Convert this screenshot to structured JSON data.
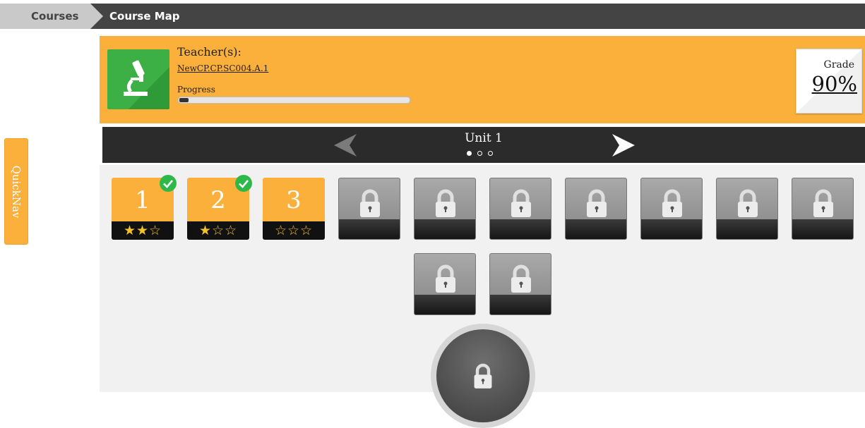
{
  "breadcrumb": {
    "courses": "Courses",
    "current": "Course Map"
  },
  "quicknav": {
    "label": "QuickNav"
  },
  "course": {
    "teacher_label": "Teacher(s):",
    "course_code": "NewCP.CP.SC004.A.1",
    "progress_label": "Progress",
    "progress_fraction": 0.04,
    "icon": "microscope-icon",
    "icon_color": "#3cb044"
  },
  "grade": {
    "label": "Grade",
    "value": "90%"
  },
  "unit": {
    "title": "Unit 1",
    "page_count": 3,
    "active_page": 0
  },
  "lessons": [
    {
      "number": "1",
      "stars": "★★☆",
      "completed": true,
      "locked": false
    },
    {
      "number": "2",
      "stars": "★☆☆",
      "completed": true,
      "locked": false
    },
    {
      "number": "3",
      "stars": "☆☆☆",
      "completed": false,
      "locked": false
    },
    {
      "locked": true
    },
    {
      "locked": true
    },
    {
      "locked": true
    },
    {
      "locked": true
    },
    {
      "locked": true
    },
    {
      "locked": true
    },
    {
      "locked": true
    },
    {
      "locked": true
    },
    {
      "locked": true
    }
  ],
  "unit_test": {
    "locked": true
  },
  "colors": {
    "accent": "#fbb03b",
    "topbar": "#444444",
    "unit_bar": "#2b2b2b",
    "check": "#2eb84a",
    "star": "#f2c12e"
  }
}
